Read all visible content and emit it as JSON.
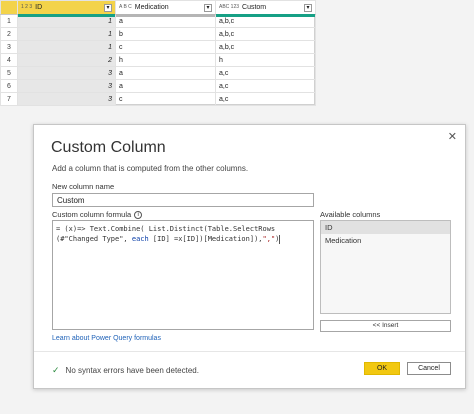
{
  "table": {
    "columns": [
      {
        "name": "ID",
        "type_icon": "1 2 3",
        "type_icon_name": "whole-number-type-icon"
      },
      {
        "name": "Medication",
        "type_icon": "A B C",
        "type_icon_name": "text-type-icon"
      },
      {
        "name": "Custom",
        "type_icon": "ABC 123",
        "type_icon_name": "any-type-icon"
      }
    ],
    "rows": [
      {
        "n": "1",
        "id": "1",
        "medication": "a",
        "custom": "a,b,c"
      },
      {
        "n": "2",
        "id": "1",
        "medication": "b",
        "custom": "a,b,c"
      },
      {
        "n": "3",
        "id": "1",
        "medication": "c",
        "custom": "a,b,c"
      },
      {
        "n": "4",
        "id": "2",
        "medication": "h",
        "custom": "h"
      },
      {
        "n": "5",
        "id": "3",
        "medication": "a",
        "custom": "a,c"
      },
      {
        "n": "6",
        "id": "3",
        "medication": "a",
        "custom": "a,c"
      },
      {
        "n": "7",
        "id": "3",
        "medication": "c",
        "custom": "a,c"
      }
    ],
    "accent_color": "#f3d34a",
    "quality_bar_color": "#16a085"
  },
  "dialog": {
    "title": "Custom Column",
    "subtitle": "Add a column that is computed from the other columns.",
    "close_glyph": "✕",
    "new_column_label": "New column name",
    "new_column_value": "Custom",
    "formula_label": "Custom column formula",
    "info_glyph": "i",
    "formula": {
      "line1_prefix": "= (x)=> Text.Combine( List.Distinct(Table.SelectRows",
      "line2_a": "(#\"Changed Type\", ",
      "line2_kw": "each",
      "line2_b": " [ID] =x[ID])[Medication]),",
      "line2_str": "\",\"",
      "line2_c": ")"
    },
    "available_label": "Available columns",
    "available_columns": [
      "ID",
      "Medication"
    ],
    "insert_label": "<< Insert",
    "learn_link": "Learn about Power Query formulas",
    "status_text": "No syntax errors have been detected.",
    "ok_label": "OK",
    "cancel_label": "Cancel"
  }
}
